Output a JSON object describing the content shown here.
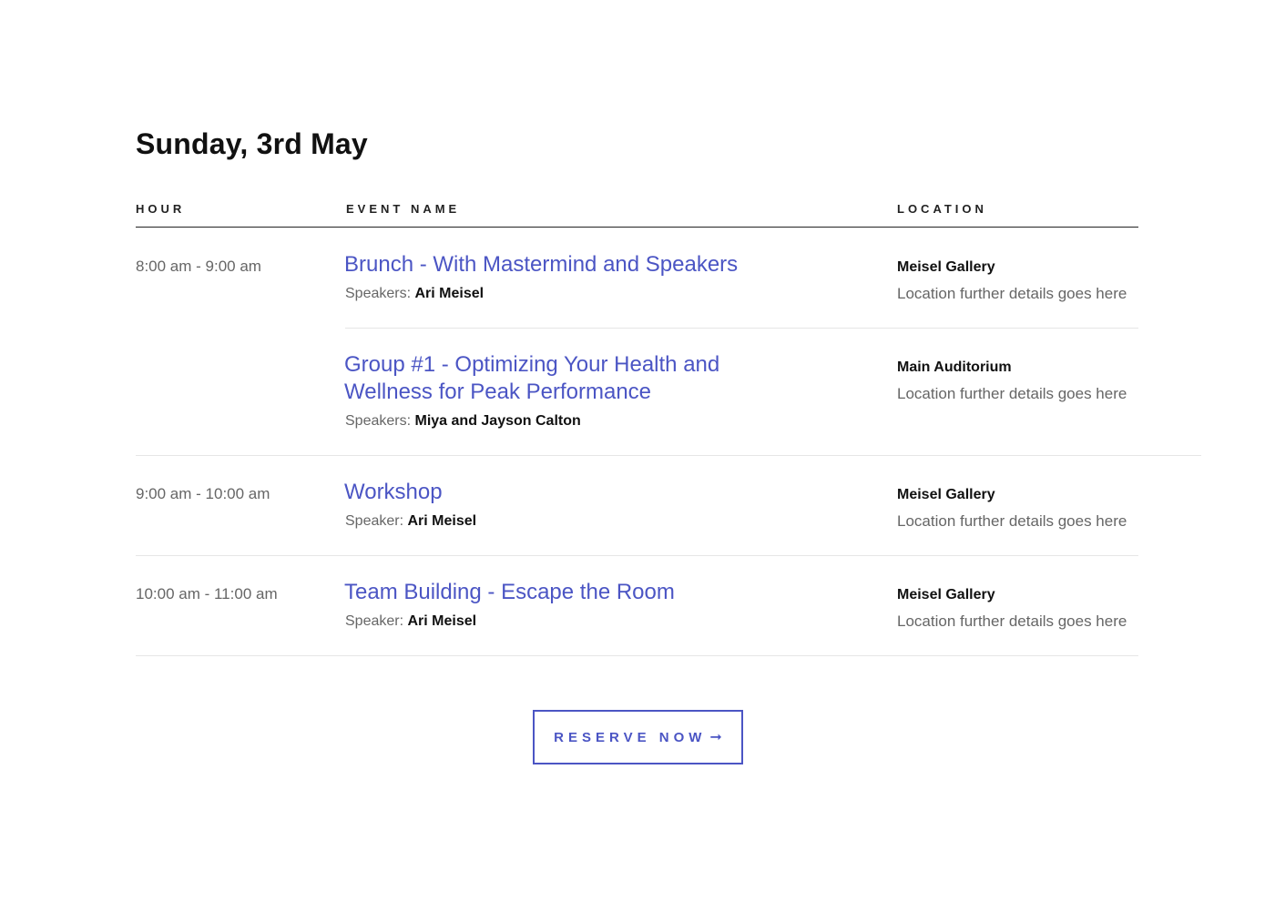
{
  "schedule": {
    "day_title": "Sunday, 3rd May",
    "columns": {
      "hour": "HOUR",
      "event": "EVENT NAME",
      "location": "LOCATION"
    },
    "slots": [
      {
        "hour": "8:00 am - 9:00 am",
        "events": [
          {
            "title": "Brunch - With Mastermind and Speakers",
            "speaker_label": "Speakers:",
            "speaker_name": "Ari Meisel",
            "location_name": "Meisel Gallery",
            "location_detail": "Location further details goes here"
          },
          {
            "title": "Group #1 - Optimizing Your Health and Wellness for Peak Performance",
            "speaker_label": "Speakers:",
            "speaker_name": "Miya and Jayson Calton",
            "location_name": "Main Auditorium",
            "location_detail": "Location further details goes here"
          }
        ]
      },
      {
        "hour": "9:00 am - 10:00 am",
        "events": [
          {
            "title": "Workshop",
            "speaker_label": "Speaker:",
            "speaker_name": "Ari Meisel",
            "location_name": "Meisel Gallery",
            "location_detail": "Location further details goes here"
          }
        ]
      },
      {
        "hour": "10:00 am - 11:00 am",
        "events": [
          {
            "title": "Team Building - Escape the Room",
            "speaker_label": "Speaker:",
            "speaker_name": "Ari Meisel",
            "location_name": "Meisel Gallery",
            "location_detail": "Location further details goes here"
          }
        ]
      }
    ]
  },
  "cta": {
    "label": "RESERVE NOW",
    "icon": "arrow-right-icon",
    "color": "#4b55c4"
  }
}
